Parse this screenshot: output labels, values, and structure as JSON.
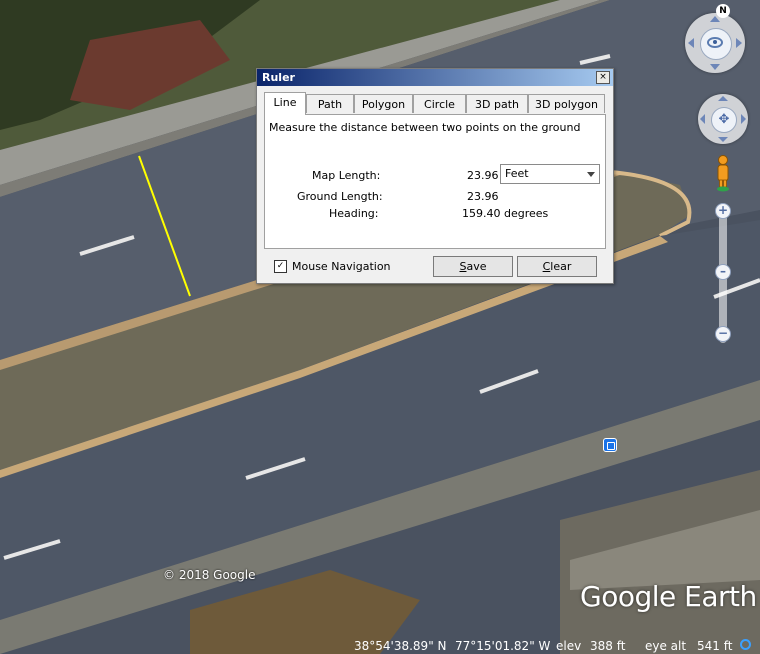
{
  "map": {
    "copyright": "© 2018 Google",
    "logo": "Google Earth",
    "status": {
      "latitude": "38°54'38.89\" N",
      "longitude": "77°15'01.82\" W",
      "elev_label": "elev",
      "elev_value": "388 ft",
      "eye_alt_label": "eye alt",
      "eye_alt_value": "541 ft"
    }
  },
  "navigation": {
    "north_label": "N",
    "zoom_in_label": "+",
    "zoom_out_label": "−",
    "move_icon": "✥"
  },
  "ruler": {
    "title": "Ruler",
    "close_label": "×",
    "tabs": [
      "Line",
      "Path",
      "Polygon",
      "Circle",
      "3D path",
      "3D polygon"
    ],
    "active_tab": "Line",
    "instruction": "Measure the distance between two points on the ground",
    "map_length_label": "Map Length:",
    "map_length_value": "23.96",
    "units": "Feet",
    "ground_length_label": "Ground Length:",
    "ground_length_value": "23.96",
    "heading_label": "Heading:",
    "heading_value": "159.40 degrees",
    "mouse_navigation_label": "Mouse Navigation",
    "mouse_navigation_checked": true,
    "check_mark": "✓",
    "save_label": "Save",
    "clear_label": "Clear"
  },
  "colors": {
    "measure_line": "#ffff00",
    "title_bar_start": "#0a246a",
    "title_bar_end": "#a6caf0"
  }
}
